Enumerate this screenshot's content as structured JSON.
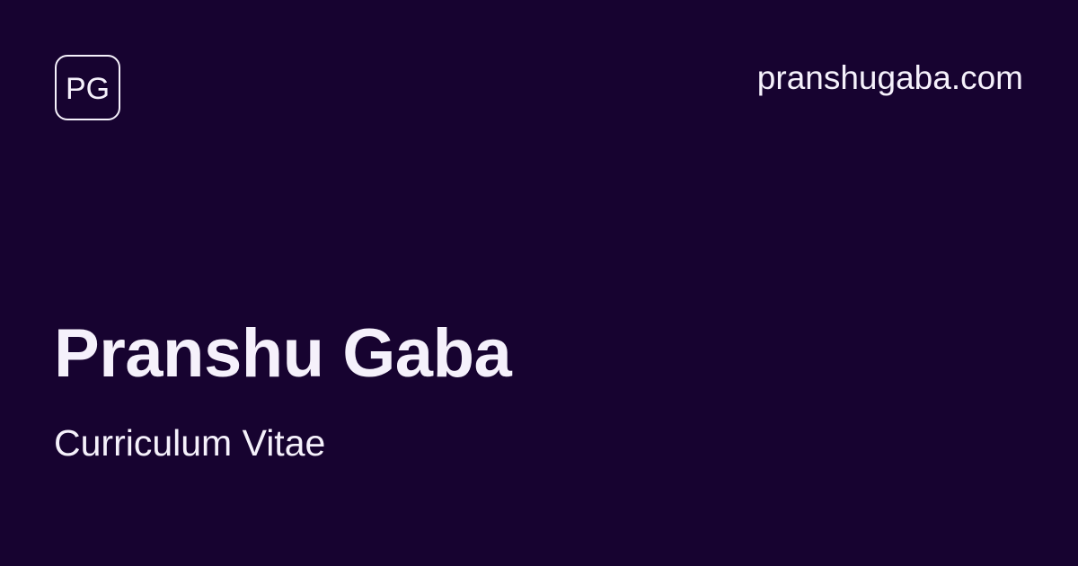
{
  "brand": {
    "logo_text": "PG",
    "domain": "pranshugaba.com"
  },
  "hero": {
    "name": "Pranshu Gaba",
    "subtitle": "Curriculum Vitae"
  },
  "colors": {
    "background": "#170330",
    "foreground": "#f5f1fb"
  }
}
